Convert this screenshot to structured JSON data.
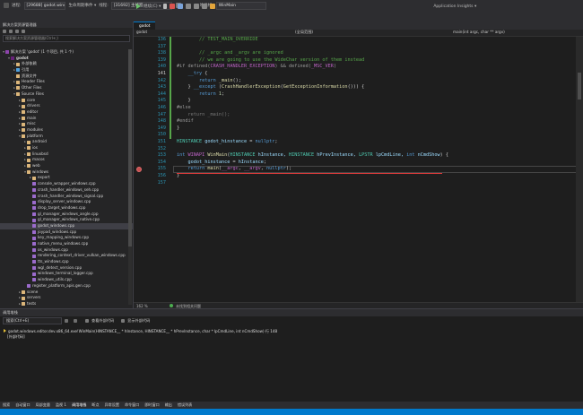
{
  "toolbar": {
    "row1": {
      "process_label": "进程:",
      "process_value": "[29688] godot.windows.editor.x...",
      "lifecycle_label": "生命周期事件 ▾",
      "thread_label": "线程:",
      "thread_value": "[31692] 主线程",
      "stack_label": "堆栈帧:",
      "stack_value": "WinMain"
    },
    "row2": {
      "continue_label": "继续(C) ▾",
      "app_insights_label": "Application Insights ▾"
    }
  },
  "solution_explorer": {
    "title": "解决方案资源管理器",
    "search_placeholder": "搜索解决方案资源管理器(Ctrl+;)",
    "items": [
      {
        "label": "解决方案 'godot' (1 个项目, 共 1 个)",
        "indent": 0,
        "icon": "solution-icon",
        "expand": "▾"
      },
      {
        "label": "godot",
        "indent": 1,
        "icon": "project-icon",
        "expand": "▾",
        "bold": true
      },
      {
        "label": "外部依赖",
        "indent": 2,
        "icon": "folder-icon",
        "expand": "▸"
      },
      {
        "label": "引用",
        "indent": 2,
        "icon": "references-icon",
        "expand": "▸"
      },
      {
        "label": "资源文件",
        "indent": 2,
        "icon": "folder-icon",
        "expand": ""
      },
      {
        "label": "Header Files",
        "indent": 2,
        "icon": "folder-icon",
        "expand": "▸"
      },
      {
        "label": "Other Files",
        "indent": 2,
        "icon": "folder-icon",
        "expand": "▸"
      },
      {
        "label": "Source Files",
        "indent": 2,
        "icon": "folder-icon",
        "expand": "▾"
      },
      {
        "label": "core",
        "indent": 3,
        "icon": "folder-icon",
        "expand": "▸"
      },
      {
        "label": "drivers",
        "indent": 3,
        "icon": "folder-icon",
        "expand": "▸"
      },
      {
        "label": "editor",
        "indent": 3,
        "icon": "folder-icon",
        "expand": "▸"
      },
      {
        "label": "main",
        "indent": 3,
        "icon": "folder-icon",
        "expand": "▸"
      },
      {
        "label": "misc",
        "indent": 3,
        "icon": "folder-icon",
        "expand": "▸"
      },
      {
        "label": "modules",
        "indent": 3,
        "icon": "folder-icon",
        "expand": "▸"
      },
      {
        "label": "platform",
        "indent": 3,
        "icon": "folder-icon",
        "expand": "▾"
      },
      {
        "label": "android",
        "indent": 4,
        "icon": "folder-icon",
        "expand": "▸"
      },
      {
        "label": "ios",
        "indent": 4,
        "icon": "folder-icon",
        "expand": "▸"
      },
      {
        "label": "linuxbsd",
        "indent": 4,
        "icon": "folder-icon",
        "expand": "▸"
      },
      {
        "label": "macos",
        "indent": 4,
        "icon": "folder-icon",
        "expand": "▸"
      },
      {
        "label": "web",
        "indent": 4,
        "icon": "folder-icon",
        "expand": "▸"
      },
      {
        "label": "windows",
        "indent": 4,
        "icon": "folder-icon",
        "expand": "▾"
      },
      {
        "label": "export",
        "indent": 5,
        "icon": "folder-icon",
        "expand": "▸"
      },
      {
        "label": "console_wrapper_windows.cpp",
        "indent": 5,
        "icon": "cpp-file-icon",
        "expand": ""
      },
      {
        "label": "crash_handler_windows_seh.cpp",
        "indent": 5,
        "icon": "cpp-file-icon",
        "expand": ""
      },
      {
        "label": "crash_handler_windows_signal.cpp",
        "indent": 5,
        "icon": "cpp-file-icon",
        "expand": ""
      },
      {
        "label": "display_server_windows.cpp",
        "indent": 5,
        "icon": "cpp-file-icon",
        "expand": ""
      },
      {
        "label": "drop_target_windows.cpp",
        "indent": 5,
        "icon": "cpp-file-icon",
        "expand": ""
      },
      {
        "label": "gl_manager_windows_angle.cpp",
        "indent": 5,
        "icon": "cpp-file-icon",
        "expand": ""
      },
      {
        "label": "gl_manager_windows_native.cpp",
        "indent": 5,
        "icon": "cpp-file-icon",
        "expand": ""
      },
      {
        "label": "godot_windows.cpp",
        "indent": 5,
        "icon": "cpp-file-icon",
        "expand": "",
        "selected": true
      },
      {
        "label": "joypad_windows.cpp",
        "indent": 5,
        "icon": "cpp-file-icon",
        "expand": ""
      },
      {
        "label": "key_mapping_windows.cpp",
        "indent": 5,
        "icon": "cpp-file-icon",
        "expand": ""
      },
      {
        "label": "native_menu_windows.cpp",
        "indent": 5,
        "icon": "cpp-file-icon",
        "expand": ""
      },
      {
        "label": "os_windows.cpp",
        "indent": 5,
        "icon": "cpp-file-icon",
        "expand": ""
      },
      {
        "label": "rendering_context_driver_vulkan_windows.cpp",
        "indent": 5,
        "icon": "cpp-file-icon",
        "expand": ""
      },
      {
        "label": "tts_windows.cpp",
        "indent": 5,
        "icon": "cpp-file-icon",
        "expand": ""
      },
      {
        "label": "wgl_detect_version.cpp",
        "indent": 5,
        "icon": "cpp-file-icon",
        "expand": ""
      },
      {
        "label": "windows_terminal_logger.cpp",
        "indent": 5,
        "icon": "cpp-file-icon",
        "expand": ""
      },
      {
        "label": "windows_utils.cpp",
        "indent": 5,
        "icon": "cpp-file-icon",
        "expand": ""
      },
      {
        "label": "register_platform_apis.gen.cpp",
        "indent": 4,
        "icon": "cpp-file-icon",
        "expand": ""
      },
      {
        "label": "scene",
        "indent": 3,
        "icon": "folder-icon",
        "expand": "▸"
      },
      {
        "label": "servers",
        "indent": 3,
        "icon": "folder-icon",
        "expand": "▸"
      },
      {
        "label": "tests",
        "indent": 3,
        "icon": "folder-icon",
        "expand": "▸"
      }
    ]
  },
  "editor": {
    "tab_label": "godot",
    "nav_left": "godot",
    "nav_mid": "(全局范围)",
    "nav_right": "main(int argc, char ** argv)",
    "lines": [
      {
        "n": "136",
        "segs": [
          {
            "t": "        ",
            "c": ""
          },
          {
            "t": "// TEST_MAIN_OVERRIDE",
            "c": "cm"
          }
        ]
      },
      {
        "n": "137",
        "segs": []
      },
      {
        "n": "138",
        "segs": [
          {
            "t": "        ",
            "c": ""
          },
          {
            "t": "// _argc and _argv are ignored",
            "c": "cm"
          }
        ]
      },
      {
        "n": "139",
        "segs": [
          {
            "t": "        ",
            "c": ""
          },
          {
            "t": "// we are going to use the WideChar version of them instead",
            "c": "cm"
          }
        ]
      },
      {
        "n": "140",
        "segs": [
          {
            "t": "#if defined(",
            "c": "pp"
          },
          {
            "t": "CRASH_HANDLER_EXCEPTION",
            "c": "mc"
          },
          {
            "t": ") && defined(",
            "c": "pp"
          },
          {
            "t": "_MSC_VER",
            "c": "mc"
          },
          {
            "t": ")",
            "c": "pp"
          }
        ]
      },
      {
        "n": "141",
        "segs": [
          {
            "t": "    ",
            "c": ""
          },
          {
            "t": "__try",
            "c": "kw"
          },
          {
            "t": " {",
            "c": ""
          }
        ]
      },
      {
        "n": "142",
        "segs": [
          {
            "t": "        ",
            "c": ""
          },
          {
            "t": "return",
            "c": "kw"
          },
          {
            "t": " ",
            "c": ""
          },
          {
            "t": "_main",
            "c": "fn"
          },
          {
            "t": "();",
            "c": ""
          }
        ]
      },
      {
        "n": "143",
        "segs": [
          {
            "t": "    } ",
            "c": ""
          },
          {
            "t": "__except",
            "c": "kw"
          },
          {
            "t": " (",
            "c": ""
          },
          {
            "t": "CrashHandlerException",
            "c": "fn"
          },
          {
            "t": "(",
            "c": ""
          },
          {
            "t": "GetExceptionInformation",
            "c": "fn"
          },
          {
            "t": "())) {",
            "c": ""
          }
        ]
      },
      {
        "n": "144",
        "segs": [
          {
            "t": "        ",
            "c": ""
          },
          {
            "t": "return",
            "c": "kw"
          },
          {
            "t": " ",
            "c": ""
          },
          {
            "t": "1",
            "c": "num"
          },
          {
            "t": ";",
            "c": ""
          }
        ]
      },
      {
        "n": "145",
        "segs": [
          {
            "t": "    }",
            "c": ""
          }
        ]
      },
      {
        "n": "146",
        "segs": [
          {
            "t": "#else",
            "c": "pp"
          }
        ]
      },
      {
        "n": "147",
        "segs": [
          {
            "t": "    return _main();",
            "c": "dim"
          }
        ]
      },
      {
        "n": "148",
        "segs": [
          {
            "t": "#endif",
            "c": "pp"
          }
        ]
      },
      {
        "n": "149",
        "segs": [
          {
            "t": "}",
            "c": ""
          }
        ]
      },
      {
        "n": "150",
        "segs": []
      },
      {
        "n": "151",
        "segs": [
          {
            "t": "HINSTANCE",
            "c": "ty"
          },
          {
            "t": " ",
            "c": ""
          },
          {
            "t": "godot_hinstance",
            "c": "var"
          },
          {
            "t": " = ",
            "c": ""
          },
          {
            "t": "nullptr",
            "c": "kw"
          },
          {
            "t": ";",
            "c": ""
          }
        ]
      },
      {
        "n": "152",
        "segs": []
      },
      {
        "n": "153",
        "segs": [
          {
            "t": "int",
            "c": "kw"
          },
          {
            "t": " ",
            "c": ""
          },
          {
            "t": "WINAPI",
            "c": "mc"
          },
          {
            "t": " ",
            "c": ""
          },
          {
            "t": "WinMain",
            "c": "fn"
          },
          {
            "t": "(",
            "c": ""
          },
          {
            "t": "HINSTANCE",
            "c": "ty"
          },
          {
            "t": " hInstance, ",
            "c": "var"
          },
          {
            "t": "HINSTANCE",
            "c": "ty"
          },
          {
            "t": " hPrevInstance, ",
            "c": "var"
          },
          {
            "t": "LPSTR",
            "c": "ty"
          },
          {
            "t": " lpCmdLine, ",
            "c": "var"
          },
          {
            "t": "int",
            "c": "kw"
          },
          {
            "t": " nCmdShow",
            "c": "var"
          },
          {
            "t": ") {",
            "c": ""
          }
        ]
      },
      {
        "n": "154",
        "segs": [
          {
            "t": "    ",
            "c": ""
          },
          {
            "t": "godot_hinstance",
            "c": "var"
          },
          {
            "t": " = ",
            "c": ""
          },
          {
            "t": "hInstance",
            "c": "var"
          },
          {
            "t": ";",
            "c": ""
          }
        ]
      },
      {
        "n": "155",
        "segs": [
          {
            "t": "    ",
            "c": ""
          },
          {
            "t": "return",
            "c": "kw"
          },
          {
            "t": " ",
            "c": ""
          },
          {
            "t": "main",
            "c": "fn"
          },
          {
            "t": "(",
            "c": ""
          },
          {
            "t": "__argc",
            "c": "mc"
          },
          {
            "t": ", ",
            "c": ""
          },
          {
            "t": "__argv",
            "c": "mc"
          },
          {
            "t": ", ",
            "c": ""
          },
          {
            "t": "nullptr",
            "c": "kw"
          },
          {
            "t": ");",
            "c": ""
          }
        ]
      },
      {
        "n": "156",
        "segs": [
          {
            "t": "}",
            "c": ""
          }
        ]
      },
      {
        "n": "157",
        "segs": []
      }
    ],
    "status": {
      "zoom": "162 %",
      "issues": "未找到相关问题"
    }
  },
  "output": {
    "title": "调用堆栈",
    "search_placeholder": "搜索(Ctrl+E)",
    "view_label": "查看外部代码",
    "show_label": "显示外部代码",
    "lines": [
      "godot.windows.editor.dev.x86_64.exe!WinMain(HINSTANCE__ * hInstance, HINSTANCE__ * hPrevInstance, char * lpCmdLine, int nCmdShow) 行 148",
      "[外部代码]"
    ]
  },
  "bottom_tabs": [
    {
      "label": "搜索"
    },
    {
      "label": "自动窗口"
    },
    {
      "label": "局部变量"
    },
    {
      "label": "监视 1"
    },
    {
      "label": "调用堆栈",
      "active": true
    },
    {
      "label": "断点"
    },
    {
      "label": "异常设置"
    },
    {
      "label": "命令窗口"
    },
    {
      "label": "即时窗口"
    },
    {
      "label": "输出"
    },
    {
      "label": "错误列表"
    }
  ]
}
